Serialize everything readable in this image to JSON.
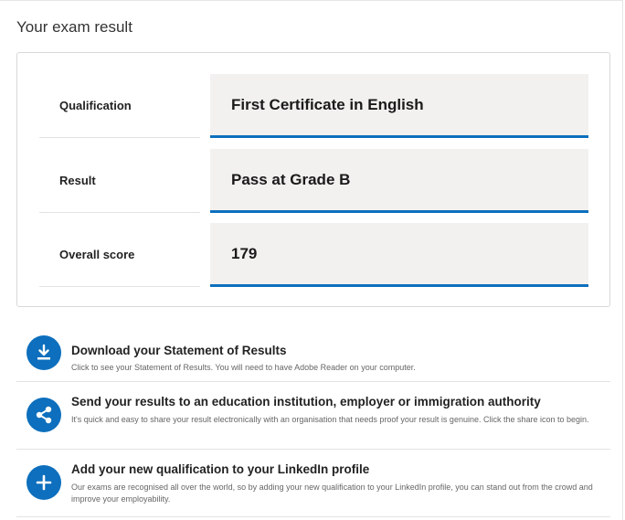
{
  "page": {
    "title": "Your exam result"
  },
  "result": {
    "rows": [
      {
        "label": "Qualification",
        "value": "First Certificate in English"
      },
      {
        "label": "Result",
        "value": "Pass at Grade B"
      },
      {
        "label": "Overall score",
        "value": "179"
      }
    ]
  },
  "actions": [
    {
      "icon": "download-icon",
      "title": "Download your Statement of Results",
      "description": "Click to see your Statement of Results. You will need to have Adobe Reader on your computer."
    },
    {
      "icon": "share-icon",
      "title": "Send your results to an education institution, employer or immigration authority",
      "description": "It's quick and easy to share your result electronically with an organisation that needs proof your result is genuine. Click the share icon to begin."
    },
    {
      "icon": "plus-icon",
      "title": "Add your new qualification to your LinkedIn profile",
      "description": "Our exams are recognised all over the world, so by adding your new qualification to your LinkedIn profile, you can stand out from the crowd and improve your employability."
    }
  ],
  "colors": {
    "accent": "#0d6fbd",
    "field_bg": "#f2f1ef"
  }
}
